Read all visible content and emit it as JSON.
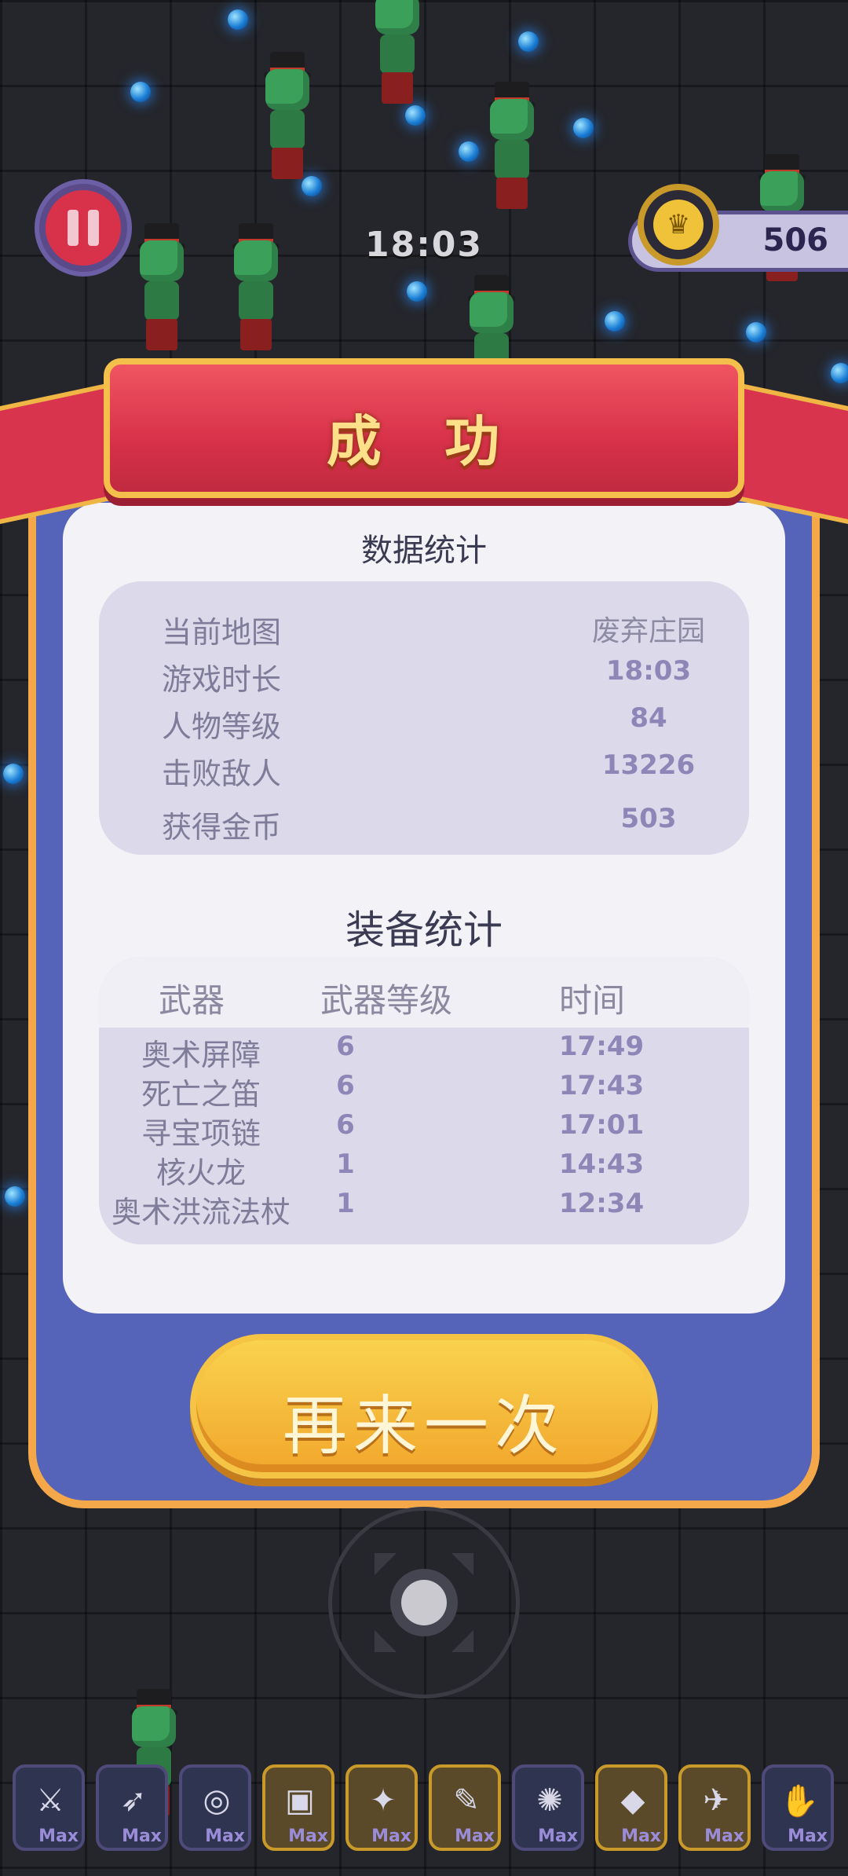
{
  "hud": {
    "timer": "18:03",
    "coins": "506"
  },
  "panel": {
    "title": "成 功",
    "stats_title": "数据统计",
    "stats": [
      {
        "label": "当前地图",
        "value": "废弃庄园"
      },
      {
        "label": "游戏时长",
        "value": "18:03"
      },
      {
        "label": "人物等级",
        "value": "84"
      },
      {
        "label": "击败敌人",
        "value": "13226"
      },
      {
        "label": "获得金币",
        "value": "503"
      }
    ],
    "equip_title": "装备统计",
    "equip_headers": {
      "weapon": "武器",
      "level": "武器等级",
      "time": "时间"
    },
    "equip": [
      {
        "name": "奥术屏障",
        "level": "6",
        "time": "17:49"
      },
      {
        "name": "死亡之笛",
        "level": "6",
        "time": "17:43"
      },
      {
        "name": "寻宝项链",
        "level": "6",
        "time": "17:01"
      },
      {
        "name": "核火龙",
        "level": "1",
        "time": "14:43"
      },
      {
        "name": "奥术洪流法杖",
        "level": "1",
        "time": "12:34"
      }
    ],
    "retry_label": "再来一次"
  },
  "inventory": {
    "max_label": "Max",
    "slots": [
      {
        "icon": "axe-icon",
        "glyph": "⚔"
      },
      {
        "icon": "flute-icon",
        "glyph": "➶"
      },
      {
        "icon": "necklace-icon",
        "glyph": "◎"
      },
      {
        "icon": "chest-icon",
        "glyph": "▣"
      },
      {
        "icon": "wand-icon",
        "glyph": "✦"
      },
      {
        "icon": "scroll-icon",
        "glyph": "✎"
      },
      {
        "icon": "spider-icon",
        "glyph": "✺"
      },
      {
        "icon": "boot-icon",
        "glyph": "◆"
      },
      {
        "icon": "bird-icon",
        "glyph": "✈"
      },
      {
        "icon": "gauntlet-icon",
        "glyph": "✋"
      }
    ]
  }
}
